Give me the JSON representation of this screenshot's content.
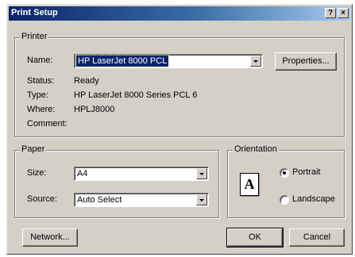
{
  "window": {
    "title": "Print Setup",
    "help_label": "?",
    "close_label": "×"
  },
  "printer": {
    "group_label": "Printer",
    "name_label": "Name:",
    "name_value": "HP LaserJet 8000 PCL",
    "properties_label": "Properties...",
    "status_label": "Status:",
    "status_value": "Ready",
    "type_label": "Type:",
    "type_value": "HP LaserJet 8000 Series PCL 6",
    "where_label": "Where:",
    "where_value": "HPLJ8000",
    "comment_label": "Comment:",
    "comment_value": ""
  },
  "paper": {
    "group_label": "Paper",
    "size_label": "Size:",
    "size_value": "A4",
    "source_label": "Source:",
    "source_value": "Auto Select"
  },
  "orientation": {
    "group_label": "Orientation",
    "icon_letter": "A",
    "portrait_label": "Portrait",
    "landscape_label": "Landscape",
    "selected": "Portrait"
  },
  "buttons": {
    "network_label": "Network...",
    "ok_label": "OK",
    "cancel_label": "Cancel"
  }
}
